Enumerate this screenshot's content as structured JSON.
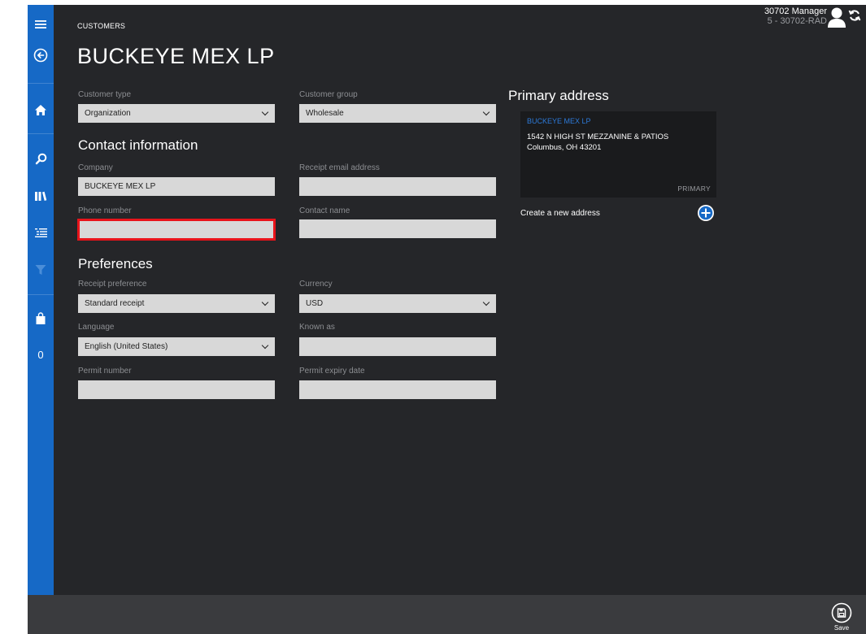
{
  "header": {
    "breadcrumb": "CUSTOMERS",
    "title": "BUCKEYE MEX LP"
  },
  "user": {
    "name": "30702 Manager",
    "store": "5 - 30702-RAD"
  },
  "sidebar": {
    "items": [
      {
        "icon": "hamburger-menu-icon"
      },
      {
        "icon": "back-arrow-icon"
      },
      {
        "icon": "home-icon"
      },
      {
        "icon": "search-icon"
      },
      {
        "icon": "products-icon"
      },
      {
        "icon": "task-list-icon"
      },
      {
        "icon": "filter-icon"
      },
      {
        "icon": "shopping-bag-icon"
      }
    ],
    "cart_count": "0"
  },
  "form": {
    "customer_type": {
      "label": "Customer type",
      "value": "Organization"
    },
    "customer_group": {
      "label": "Customer group",
      "value": "Wholesale"
    },
    "contact_heading": "Contact information",
    "company": {
      "label": "Company",
      "value": "BUCKEYE MEX LP"
    },
    "receipt_email": {
      "label": "Receipt email address",
      "value": ""
    },
    "phone": {
      "label": "Phone number",
      "value": ""
    },
    "contact_name": {
      "label": "Contact name",
      "value": ""
    },
    "preferences_heading": "Preferences",
    "receipt_pref": {
      "label": "Receipt preference",
      "value": "Standard receipt"
    },
    "currency": {
      "label": "Currency",
      "value": "USD"
    },
    "language": {
      "label": "Language",
      "value": "English (United States)"
    },
    "known_as": {
      "label": "Known as",
      "value": ""
    },
    "permit_number": {
      "label": "Permit number",
      "value": ""
    },
    "permit_expiry": {
      "label": "Permit expiry date",
      "value": ""
    }
  },
  "address": {
    "heading": "Primary address",
    "name": "BUCKEYE MEX LP",
    "line1": "1542 N HIGH ST MEZZANINE & PATIOS",
    "line2": "Columbus, OH 43201",
    "tag": "PRIMARY",
    "create_label": "Create a new address"
  },
  "footer": {
    "save_label": "Save"
  },
  "colors": {
    "sidebar": "#1669c6",
    "background": "#252629",
    "highlight": "#e8141b",
    "link": "#2d7ad8"
  }
}
